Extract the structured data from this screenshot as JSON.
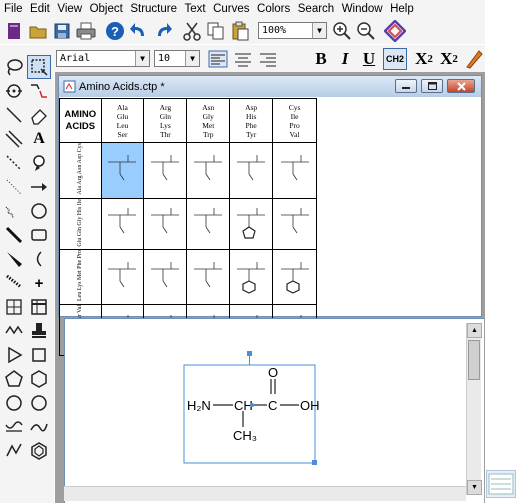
{
  "menu": [
    "File",
    "Edit",
    "View",
    "Object",
    "Structure",
    "Text",
    "Curves",
    "Colors",
    "Search",
    "Window",
    "Help"
  ],
  "toolbar": {
    "zoom_value": "100%",
    "font_name": "Arial",
    "font_size": "10",
    "bold_label": "B",
    "italic_label": "I",
    "underline_label": "U",
    "chem_label": "CH2",
    "sub_label": "X",
    "sub_digit": "2",
    "sup_label": "X",
    "sup_digit": "2",
    "icons": [
      "new-document-icon",
      "open-icon",
      "save-icon",
      "print-icon",
      "help-icon",
      "undo-icon",
      "redo-icon",
      "cut-icon",
      "copy-icon",
      "paste-icon",
      "zoom-in-icon",
      "zoom-out-icon",
      "diamond-icon",
      "align-left-icon",
      "align-center-icon",
      "align-right-icon",
      "color-icon"
    ]
  },
  "palette": {
    "tools": [
      "lasso-icon",
      "marquee-icon",
      "rotate-icon",
      "chain-icon",
      "bond-icon",
      "eraser-icon",
      "double-bond-icon",
      "text-tool-icon",
      "dashed-bond-icon",
      "orbital-icon",
      "hash-bond-icon",
      "arrow-icon",
      "wavy-bond-icon",
      "arc-icon",
      "bold-bond-icon",
      "box-icon",
      "wedge-bond-icon",
      "bracket-icon",
      "hashed-wedge-icon",
      "charge-icon",
      "table-icon",
      "grid-icon",
      "chain-tool-icon",
      "stamp-icon",
      "triangle-icon",
      "square-icon",
      "pentagon-icon",
      "hexagon-icon",
      "circle-icon",
      "octagon-icon",
      "template-icon",
      "curve-icon",
      "cyclopentane-icon",
      "hexagon-ring-icon"
    ]
  },
  "document": {
    "title": "Amino Acids.ctp *",
    "corner_title": "AMINO\nACIDS",
    "column_headers": [
      [
        "Ala",
        "Glu",
        "Leu",
        "Ser"
      ],
      [
        "Arg",
        "Gln",
        "Lys",
        "Thr"
      ],
      [
        "Asn",
        "Gly",
        "Met",
        "Trp"
      ],
      [
        "Asp",
        "His",
        "Phe",
        "Tyr"
      ],
      [
        "Cys",
        "Ile",
        "Pro",
        "Val"
      ]
    ],
    "row_headers": [
      "Ala Arg Asn Asp Cys",
      "Glu Gln Gly His Ile",
      "Leu Lys Met Phe Pro",
      "Ser Thr Trp Tyr Val"
    ]
  },
  "molecule": {
    "left_group": "H₂N",
    "center": "CH",
    "carbonyl_c": "C",
    "oxygen": "O",
    "oh": "OH",
    "methyl": "CH₃"
  }
}
